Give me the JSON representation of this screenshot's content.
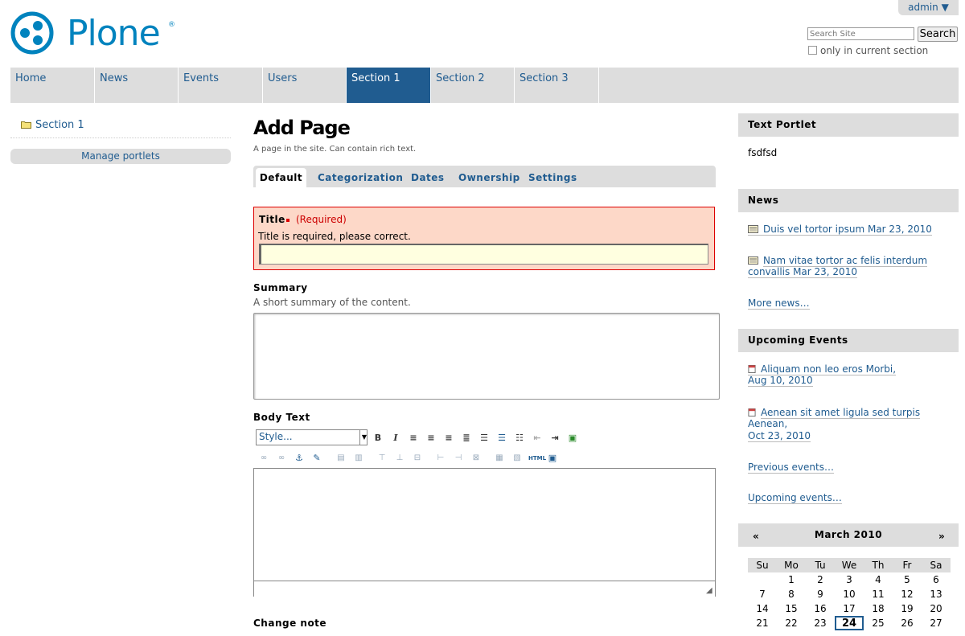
{
  "header": {
    "user_menu": "admin ▼",
    "logo_text": "Plone",
    "logo_mark": "®",
    "search_placeholder": "Search Site",
    "search_button": "Search",
    "only_current_section": "only in current section"
  },
  "nav": {
    "tabs": [
      {
        "label": "Home"
      },
      {
        "label": "News"
      },
      {
        "label": "Events"
      },
      {
        "label": "Users"
      },
      {
        "label": "Section 1"
      },
      {
        "label": "Section 2"
      },
      {
        "label": "Section 3"
      }
    ]
  },
  "left": {
    "section_link": "Section 1",
    "manage_portlets": "Manage portlets"
  },
  "main": {
    "title": "Add Page",
    "description": "A page in the site. Can contain rich text.",
    "tabs": [
      {
        "label": "Default"
      },
      {
        "label": "Categorization"
      },
      {
        "label": "Dates"
      },
      {
        "label": "Ownership"
      },
      {
        "label": "Settings"
      }
    ],
    "title_field": {
      "label": "Title",
      "required": "(Required)",
      "error": "Title is required, please correct."
    },
    "summary_field": {
      "label": "Summary",
      "help": "A short summary of the content."
    },
    "body_field": {
      "label": "Body Text",
      "style_select": "Style..."
    },
    "change_note": {
      "label": "Change note"
    }
  },
  "right": {
    "text_portlet": {
      "title": "Text Portlet",
      "body": "fsdfsd"
    },
    "news": {
      "title": "News",
      "items": [
        {
          "text": "Duis vel tortor ipsum Mar 23, 2010"
        },
        {
          "line1": "Nam vitae tortor ac felis interdum",
          "line2": "convallis Mar 23, 2010"
        }
      ],
      "more": "More news…"
    },
    "events": {
      "title": "Upcoming Events",
      "items": [
        {
          "line1": "Aliquam non leo eros Morbi,",
          "line2": "Aug 10, 2010"
        },
        {
          "line1": "Aenean sit amet ligula sed turpis",
          "line2": "Aenean,",
          "line3": "Oct 23, 2010"
        }
      ],
      "previous": "Previous events…",
      "upcoming": "Upcoming events…"
    },
    "calendar": {
      "prev": "«",
      "next": "»",
      "month": "March 2010",
      "days": [
        "Su",
        "Mo",
        "Tu",
        "We",
        "Th",
        "Fr",
        "Sa"
      ],
      "weeks": [
        [
          "",
          "1",
          "2",
          "3",
          "4",
          "5",
          "6"
        ],
        [
          "7",
          "8",
          "9",
          "10",
          "11",
          "12",
          "13"
        ],
        [
          "14",
          "15",
          "16",
          "17",
          "18",
          "19",
          "20"
        ],
        [
          "21",
          "22",
          "23",
          "24",
          "25",
          "26",
          "27"
        ]
      ],
      "today": "24"
    }
  },
  "colors": {
    "brand": "#0083be",
    "nav_selected": "#205c90",
    "error_bg": "#fdd8c8",
    "error_border": "#dd0000"
  }
}
